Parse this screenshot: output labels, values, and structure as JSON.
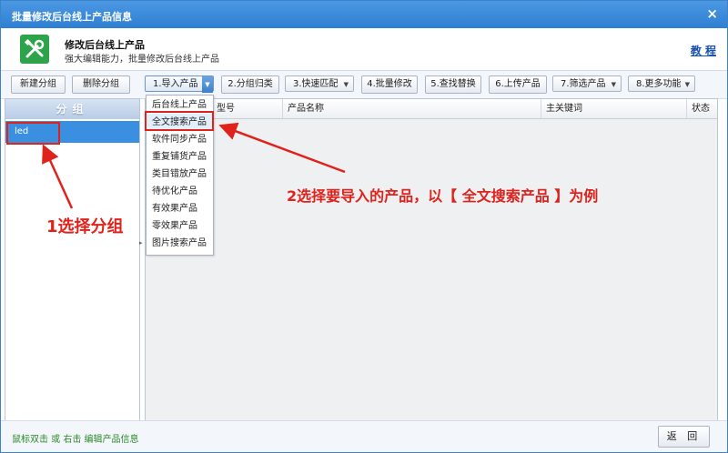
{
  "window": {
    "title": "批量修改后台线上产品信息",
    "close_glyph": "×"
  },
  "header": {
    "app_icon": "tools-icon",
    "title": "修改后台线上产品",
    "subtitle": "强大编辑能力，批量修改后台线上产品",
    "tutorial_link": "教 程"
  },
  "toolbar": {
    "new_group": "新建分组",
    "delete_group": "删除分组",
    "buttons": [
      {
        "label": "1.导入产品",
        "has_dropdown": true
      },
      {
        "label": "2.分组归类",
        "has_dropdown": false
      },
      {
        "label": "3.快速匹配",
        "has_dropdown": true
      },
      {
        "label": "4.批量修改",
        "has_dropdown": false
      },
      {
        "label": "5.查找替换",
        "has_dropdown": false
      },
      {
        "label": "6.上传产品",
        "has_dropdown": false
      },
      {
        "label": "7.筛选产品",
        "has_dropdown": true
      },
      {
        "label": "8.更多功能",
        "has_dropdown": true
      }
    ]
  },
  "groups": {
    "header": "分组",
    "items": [
      {
        "label": "led",
        "selected": true
      }
    ]
  },
  "dropdown": {
    "items": [
      {
        "label": "后台线上产品",
        "selected": false
      },
      {
        "label": "全文搜索产品",
        "selected": true
      },
      {
        "label": "软件同步产品",
        "selected": false
      },
      {
        "label": "重复铺货产品",
        "selected": false
      },
      {
        "label": "类目错放产品",
        "selected": false
      },
      {
        "label": "待优化产品",
        "selected": false
      },
      {
        "label": "有效果产品",
        "selected": false
      },
      {
        "label": "零效果产品",
        "selected": false
      },
      {
        "label": "图片搜索产品",
        "selected": false
      }
    ]
  },
  "table": {
    "columns": [
      "型号",
      "产品名称",
      "主关键词",
      "状态"
    ]
  },
  "annotations": {
    "step1": "1选择分组",
    "step2": "2选择要导入的产品，以【 全文搜索产品 】为例",
    "color": "#e0221c"
  },
  "statusbar": {
    "hint": "鼠标双击 或 右击 编辑产品信息",
    "back_button": "返 回"
  },
  "colors": {
    "titlebar": "#3b8ad9",
    "accent": "#3b8fe0",
    "hint_green": "#2a8a2a"
  }
}
